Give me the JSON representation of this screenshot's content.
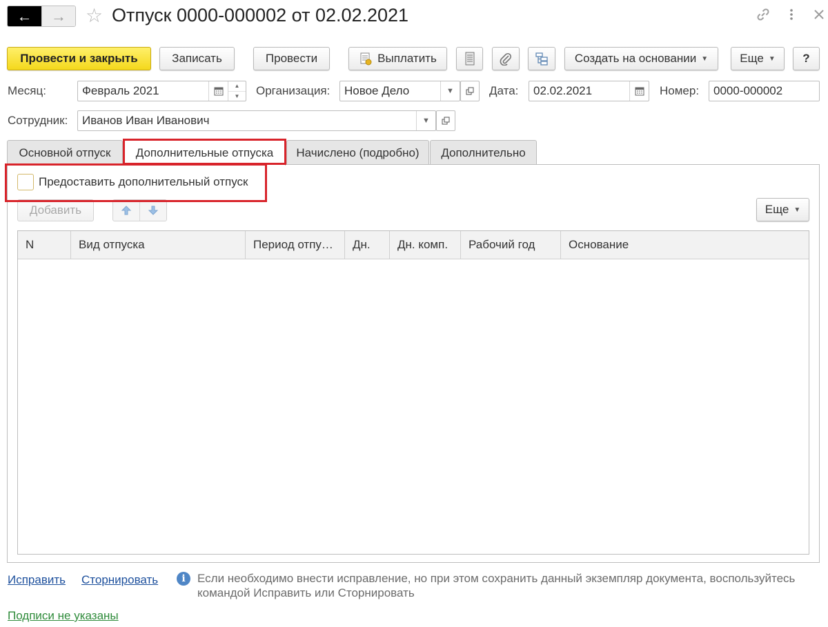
{
  "header": {
    "back_icon": "arrow-left-icon",
    "forward_icon": "arrow-right-icon",
    "favorite_icon": "star-icon",
    "title": "Отпуск 0000-000002 от 02.02.2021",
    "link_icon": "link-icon",
    "more_icon": "vertical-dots-icon",
    "close_icon": "close-icon"
  },
  "toolbar": {
    "post_close": "Провести и закрыть",
    "save": "Записать",
    "post": "Провести",
    "pay": "Выплатить",
    "create_based": "Создать на основании",
    "more": "Еще",
    "help": "?",
    "accent_color": "#f4d81c"
  },
  "fields": {
    "month_label": "Месяц:",
    "month_value": "Февраль 2021",
    "org_label": "Организация:",
    "org_value": "Новое Дело",
    "date_label": "Дата:",
    "date_value": "02.02.2021",
    "number_label": "Номер:",
    "number_value": "0000-000002",
    "employee_label": "Сотрудник:",
    "employee_value": "Иванов Иван Иванович"
  },
  "tabs": [
    {
      "label": "Основной отпуск",
      "active": false
    },
    {
      "label": "Дополнительные отпуска",
      "active": true
    },
    {
      "label": "Начислено (подробно)",
      "active": false
    },
    {
      "label": "Дополнительно",
      "active": false
    }
  ],
  "panel": {
    "checkbox_label": "Предоставить дополнительный отпуск",
    "checkbox_checked": false,
    "add_button": "Добавить",
    "up_icon": "arrow-up-icon",
    "down_icon": "arrow-down-icon",
    "more": "Еще",
    "highlight_color": "#d8232a"
  },
  "table": {
    "columns": [
      "N",
      "Вид отпуска",
      "Период отпу…",
      "Дн.",
      "Дн. комп.",
      "Рабочий год",
      "Основание"
    ],
    "rows": []
  },
  "footer": {
    "fix_link": "Исправить",
    "storno_link": "Сторнировать",
    "info_icon": "info-icon",
    "info_text": "Если необходимо внести исправление, но при этом сохранить данный экземпляр документа, воспользуйтесь командой Исправить или Сторнировать",
    "signatures_link": "Подписи не указаны"
  }
}
